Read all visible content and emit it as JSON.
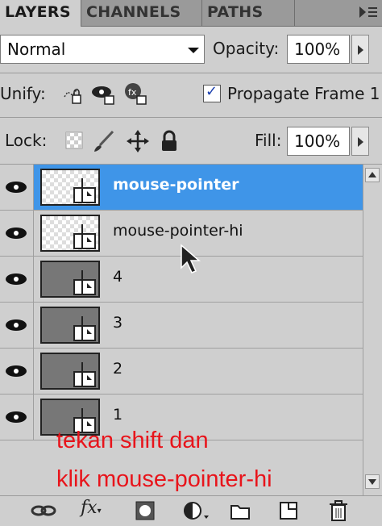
{
  "tabs": [
    "LAYERS",
    "CHANNELS",
    "PATHS"
  ],
  "blend_mode": "Normal",
  "opacity": {
    "label": "Opacity:",
    "value": "100%"
  },
  "unify": {
    "label": "Unify:",
    "icons": [
      "unify-position-icon",
      "unify-visibility-icon",
      "unify-style-icon"
    ]
  },
  "propagate": {
    "label": "Propagate Frame 1",
    "checked": true,
    "check": "✓"
  },
  "lock": {
    "label": "Lock:",
    "icons": [
      "lock-transparent-icon",
      "lock-image-icon",
      "lock-position-icon",
      "lock-all-icon"
    ]
  },
  "fill": {
    "label": "Fill:",
    "value": "100%"
  },
  "layers": [
    {
      "name": "mouse-pointer",
      "selected": true,
      "thumb": "transparent"
    },
    {
      "name": "mouse-pointer-hi",
      "selected": false,
      "thumb": "transparent"
    },
    {
      "name": "4",
      "selected": false,
      "thumb": "gray"
    },
    {
      "name": "3",
      "selected": false,
      "thumb": "gray"
    },
    {
      "name": "2",
      "selected": false,
      "thumb": "gray"
    },
    {
      "name": "1",
      "selected": false,
      "thumb": "gray"
    }
  ],
  "annotation": [
    "tekan shift dan",
    "klik mouse-pointer-hi"
  ],
  "annotation_color": "#e8141b",
  "selection_color": "#3f95e8",
  "bottom_icons": [
    "link-layers-icon",
    "fx-icon",
    "add-mask-icon",
    "adjustment-layer-icon",
    "new-group-icon",
    "new-layer-icon",
    "trash-icon"
  ],
  "fx_label": "fx"
}
